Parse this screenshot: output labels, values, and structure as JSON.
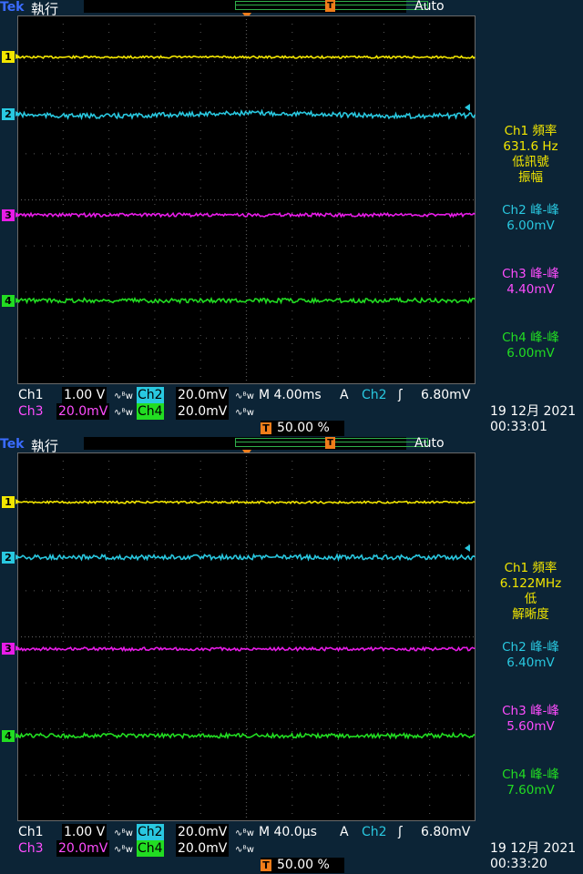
{
  "colors": {
    "ch1": "#f2e600",
    "ch2": "#29c8e0",
    "ch3": "#e81ce8",
    "ch4": "#22dd22",
    "ch3_text": "#ff4dff",
    "trigger": "#f07d1a",
    "bezel": "#0c2436",
    "graticule": "#000000",
    "brand": "#3a6cff"
  },
  "screens": [
    {
      "header": {
        "brand": "Tek",
        "mode": "執行",
        "acquisition": "Auto"
      },
      "channels": [
        {
          "label": "1",
          "level": 0.887
        },
        {
          "label": "2",
          "level": 0.731
        },
        {
          "label": "3",
          "level": 0.459
        },
        {
          "label": "4",
          "level": 0.227
        }
      ],
      "trigger_arrow_level": 0.751,
      "side_panel": [
        {
          "channel": "ch1",
          "lines": [
            "Ch1 頻率",
            "631.6 Hz",
            "低訊號",
            "振幅"
          ]
        },
        {
          "channel": "ch2",
          "lines": [
            "Ch2 峰-峰",
            "6.00mV"
          ]
        },
        {
          "channel": "ch3",
          "lines": [
            "Ch3 峰-峰",
            "4.40mV"
          ]
        },
        {
          "channel": "ch4",
          "lines": [
            "Ch4 峰-峰",
            "6.00mV"
          ]
        }
      ],
      "readouts": {
        "ch1_name": "Ch1",
        "ch1_scale": "1.00 V",
        "ch2_name": "Ch2",
        "ch2_scale": "20.0mV",
        "ch3_name": "Ch3",
        "ch3_scale": "20.0mV",
        "ch4_name": "Ch4",
        "ch4_scale": "20.0mV",
        "timebase": "M 4.00ms",
        "trigger_type": "A",
        "trigger_source": "Ch2",
        "trigger_slope": "ʃ",
        "trigger_level": "6.80mV",
        "trigger_position": "50.00 %",
        "trigger_icon": "T"
      },
      "date": "19 12月 2021",
      "time": "00:33:01"
    },
    {
      "header": {
        "brand": "Tek",
        "mode": "執行",
        "acquisition": "Auto"
      },
      "channels": [
        {
          "label": "1",
          "level": 0.865
        },
        {
          "label": "2",
          "level": 0.716
        },
        {
          "label": "3",
          "level": 0.467
        },
        {
          "label": "4",
          "level": 0.232
        }
      ],
      "trigger_arrow_level": 0.74,
      "side_panel": [
        {
          "channel": "ch1",
          "lines": [
            "Ch1 頻率",
            "6.122MHz",
            "低",
            "解晰度"
          ]
        },
        {
          "channel": "ch2",
          "lines": [
            "Ch2 峰-峰",
            "6.40mV"
          ]
        },
        {
          "channel": "ch3",
          "lines": [
            "Ch3 峰-峰",
            "5.60mV"
          ]
        },
        {
          "channel": "ch4",
          "lines": [
            "Ch4 峰-峰",
            "7.60mV"
          ]
        }
      ],
      "readouts": {
        "ch1_name": "Ch1",
        "ch1_scale": "1.00 V",
        "ch2_name": "Ch2",
        "ch2_scale": "20.0mV",
        "ch3_name": "Ch3",
        "ch3_scale": "20.0mV",
        "ch4_name": "Ch4",
        "ch4_scale": "20.0mV",
        "timebase": "M 40.0µs",
        "trigger_type": "A",
        "trigger_source": "Ch2",
        "trigger_slope": "ʃ",
        "trigger_level": "6.80mV",
        "trigger_position": "50.00 %",
        "trigger_icon": "T"
      },
      "date": "19 12月 2021",
      "time": "00:33:20"
    }
  ],
  "icons": {
    "coupling_icon": "∿ᴮw"
  }
}
